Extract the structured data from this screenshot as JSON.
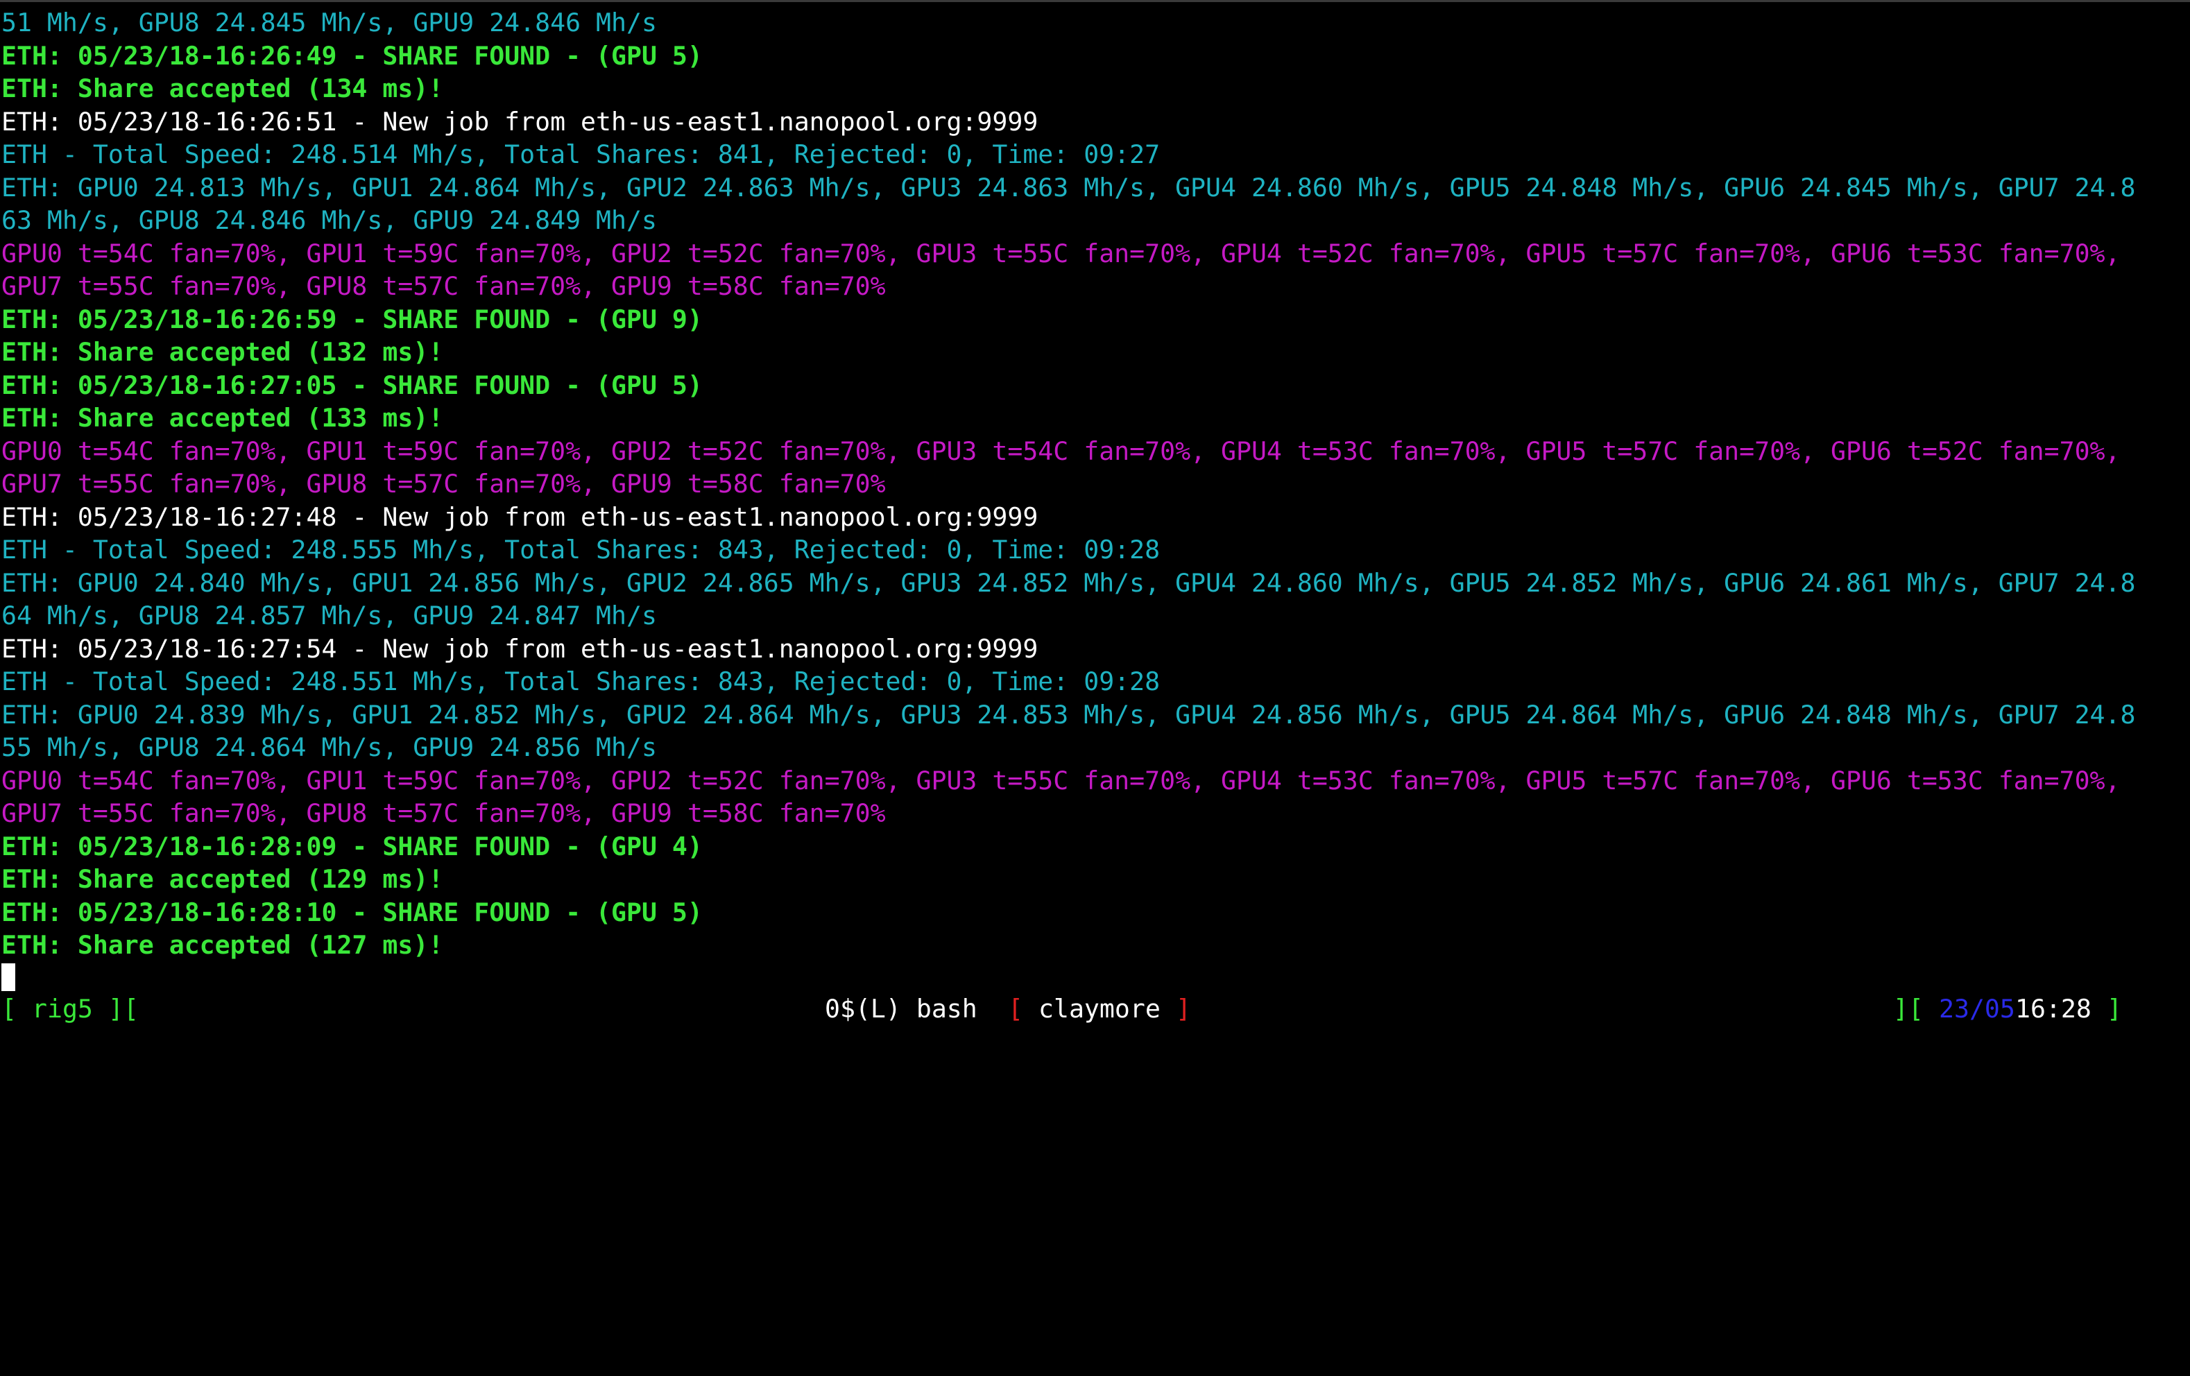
{
  "terminal": {
    "lines": [
      {
        "text": "51 Mh/s, GPU8 24.845 Mh/s, GPU9 24.846 Mh/s",
        "style": "cyan"
      },
      {
        "text": "ETH: 05/23/18-16:26:49 - SHARE FOUND - (GPU 5)",
        "style": "green"
      },
      {
        "text": "ETH: Share accepted (134 ms)!",
        "style": "green"
      },
      {
        "text": "ETH: 05/23/18-16:26:51 - New job from eth-us-east1.nanopool.org:9999",
        "style": "white"
      },
      {
        "text": "ETH - Total Speed: 248.514 Mh/s, Total Shares: 841, Rejected: 0, Time: 09:27",
        "style": "cyan"
      },
      {
        "text": "ETH: GPU0 24.813 Mh/s, GPU1 24.864 Mh/s, GPU2 24.863 Mh/s, GPU3 24.863 Mh/s, GPU4 24.860 Mh/s, GPU5 24.848 Mh/s, GPU6 24.845 Mh/s, GPU7 24.8",
        "style": "cyan"
      },
      {
        "text": "63 Mh/s, GPU8 24.846 Mh/s, GPU9 24.849 Mh/s",
        "style": "cyan"
      },
      {
        "text": "GPU0 t=54C fan=70%, GPU1 t=59C fan=70%, GPU2 t=52C fan=70%, GPU3 t=55C fan=70%, GPU4 t=52C fan=70%, GPU5 t=57C fan=70%, GPU6 t=53C fan=70%,",
        "style": "magenta"
      },
      {
        "text": "GPU7 t=55C fan=70%, GPU8 t=57C fan=70%, GPU9 t=58C fan=70%",
        "style": "magenta"
      },
      {
        "text": "ETH: 05/23/18-16:26:59 - SHARE FOUND - (GPU 9)",
        "style": "green"
      },
      {
        "text": "ETH: Share accepted (132 ms)!",
        "style": "green"
      },
      {
        "text": "ETH: 05/23/18-16:27:05 - SHARE FOUND - (GPU 5)",
        "style": "green"
      },
      {
        "text": "ETH: Share accepted (133 ms)!",
        "style": "green"
      },
      {
        "text": "GPU0 t=54C fan=70%, GPU1 t=59C fan=70%, GPU2 t=52C fan=70%, GPU3 t=54C fan=70%, GPU4 t=53C fan=70%, GPU5 t=57C fan=70%, GPU6 t=52C fan=70%,",
        "style": "magenta"
      },
      {
        "text": "GPU7 t=55C fan=70%, GPU8 t=57C fan=70%, GPU9 t=58C fan=70%",
        "style": "magenta"
      },
      {
        "text": "ETH: 05/23/18-16:27:48 - New job from eth-us-east1.nanopool.org:9999",
        "style": "white"
      },
      {
        "text": "ETH - Total Speed: 248.555 Mh/s, Total Shares: 843, Rejected: 0, Time: 09:28",
        "style": "cyan"
      },
      {
        "text": "ETH: GPU0 24.840 Mh/s, GPU1 24.856 Mh/s, GPU2 24.865 Mh/s, GPU3 24.852 Mh/s, GPU4 24.860 Mh/s, GPU5 24.852 Mh/s, GPU6 24.861 Mh/s, GPU7 24.8",
        "style": "cyan"
      },
      {
        "text": "64 Mh/s, GPU8 24.857 Mh/s, GPU9 24.847 Mh/s",
        "style": "cyan"
      },
      {
        "text": "ETH: 05/23/18-16:27:54 - New job from eth-us-east1.nanopool.org:9999",
        "style": "white"
      },
      {
        "text": "ETH - Total Speed: 248.551 Mh/s, Total Shares: 843, Rejected: 0, Time: 09:28",
        "style": "cyan"
      },
      {
        "text": "ETH: GPU0 24.839 Mh/s, GPU1 24.852 Mh/s, GPU2 24.864 Mh/s, GPU3 24.853 Mh/s, GPU4 24.856 Mh/s, GPU5 24.864 Mh/s, GPU6 24.848 Mh/s, GPU7 24.8",
        "style": "cyan"
      },
      {
        "text": "55 Mh/s, GPU8 24.864 Mh/s, GPU9 24.856 Mh/s",
        "style": "cyan"
      },
      {
        "text": "GPU0 t=54C fan=70%, GPU1 t=59C fan=70%, GPU2 t=52C fan=70%, GPU3 t=55C fan=70%, GPU4 t=53C fan=70%, GPU5 t=57C fan=70%, GPU6 t=53C fan=70%,",
        "style": "magenta"
      },
      {
        "text": "GPU7 t=55C fan=70%, GPU8 t=57C fan=70%, GPU9 t=58C fan=70%",
        "style": "magenta"
      },
      {
        "text": "ETH: 05/23/18-16:28:09 - SHARE FOUND - (GPU 4)",
        "style": "green"
      },
      {
        "text": "ETH: Share accepted (129 ms)!",
        "style": "green"
      },
      {
        "text": "ETH: 05/23/18-16:28:10 - SHARE FOUND - (GPU 5)",
        "style": "green"
      },
      {
        "text": "ETH: Share accepted (127 ms)!",
        "style": "green"
      }
    ]
  },
  "status_bar": {
    "left_open": "[ ",
    "host": "rig5",
    "left_close": " ][",
    "window_prefix": "0$(L) bash  ",
    "active_open": "[ ",
    "active_window": "claymore",
    "active_close": " ]",
    "right_open": "][ ",
    "date": "23/05",
    "time": "16:28",
    "right_close": " ]"
  },
  "colors": {
    "background": "#000000",
    "cyan": "#1fb3c2",
    "green": "#3ae83a",
    "magenta": "#c51ac5",
    "white": "#ffffff",
    "red": "#e12020",
    "blue": "#2a2ae8"
  }
}
